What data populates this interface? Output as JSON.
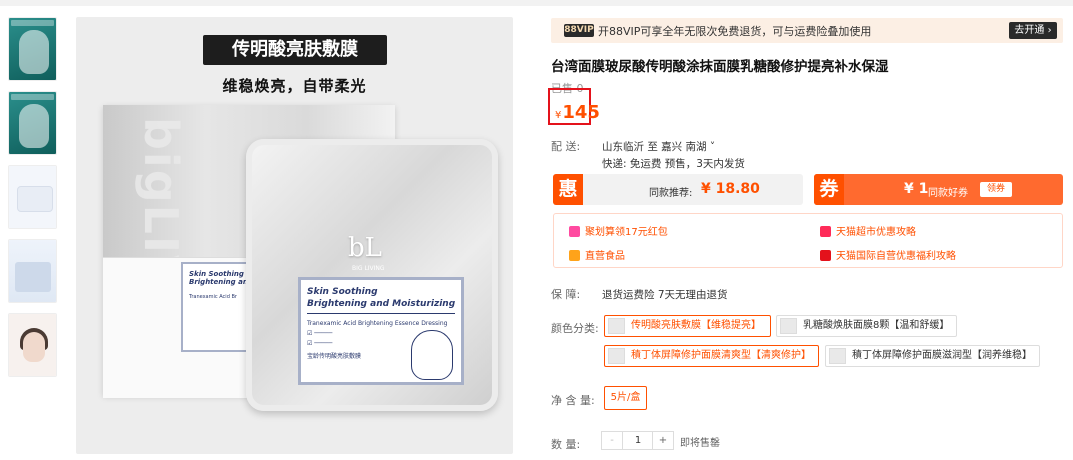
{
  "main_image": {
    "title": "传明酸亮肤敷膜",
    "subtitle": "维稳焕亮，自带柔光",
    "brand_logo": "bL",
    "brand_sub": "BIG LIVING",
    "back_box_text": "bigLIVING",
    "label_title_1": "Skin Soothing",
    "label_title_2": "Brightening and Moisturizing",
    "label_line": "Tranexamic Acid Brightening Essence Dressing",
    "label_cn": "宝龄传明酸亮肤敷膜",
    "small_label_title": "Skin Soothing Brightening and",
    "small_label_line": "Tranexamic Acid Br"
  },
  "vip": {
    "badge": "88VIP",
    "text": "开88VIP可享全年无限次免费退货，可与运费险叠加使用",
    "button": "去开通 ›"
  },
  "product": {
    "title": "台湾面膜玻尿酸传明酸涂抹面膜乳糖酸修护提亮补水保湿",
    "sold": "已售 0",
    "price_symbol": "¥",
    "price": "145"
  },
  "delivery": {
    "label": "配  送:",
    "route": "山东临沂  至  嘉兴 南湖 ˅",
    "line2": "快递: 免运费  预售，3天内发货"
  },
  "coupons": {
    "hui_tag": "惠",
    "hui_label": "同款推荐:",
    "hui_amount": "¥ 18.80",
    "quan_tag": "券",
    "quan_amount": "¥ 1",
    "quan_label": "同款好券",
    "quan_button": "领券"
  },
  "promos": [
    {
      "text": "聚划算领17元红包"
    },
    {
      "text": "天猫超市优惠攻略"
    },
    {
      "text": "直营食品"
    },
    {
      "text": "天猫国际自营优惠福利攻略"
    }
  ],
  "guarantee": {
    "label": "保  障:",
    "text": "退货运费险  7天无理由退货"
  },
  "colors": {
    "label": "颜色分类:",
    "options": [
      {
        "text": "传明酸亮肤敷膜【维稳提亮】",
        "selected": true
      },
      {
        "text": "乳糖酸焕肤面膜8颗【温和舒缓】",
        "selected": false
      },
      {
        "text": "積丁体屏障修护面膜清爽型【清爽修护】",
        "selected": true
      },
      {
        "text": "積丁体屏障修护面膜滋润型【润养维稳】",
        "selected": false
      }
    ]
  },
  "net": {
    "label": "净 含 量:",
    "value": "5片/盒"
  },
  "quantity": {
    "label": "数     量:",
    "minus": "-",
    "value": "1",
    "plus": "+",
    "note": "即将售罄"
  },
  "theme": {
    "accent": "#ff5000",
    "price_box_border": "#e4121b",
    "vip_bg": "#fcefe4"
  }
}
